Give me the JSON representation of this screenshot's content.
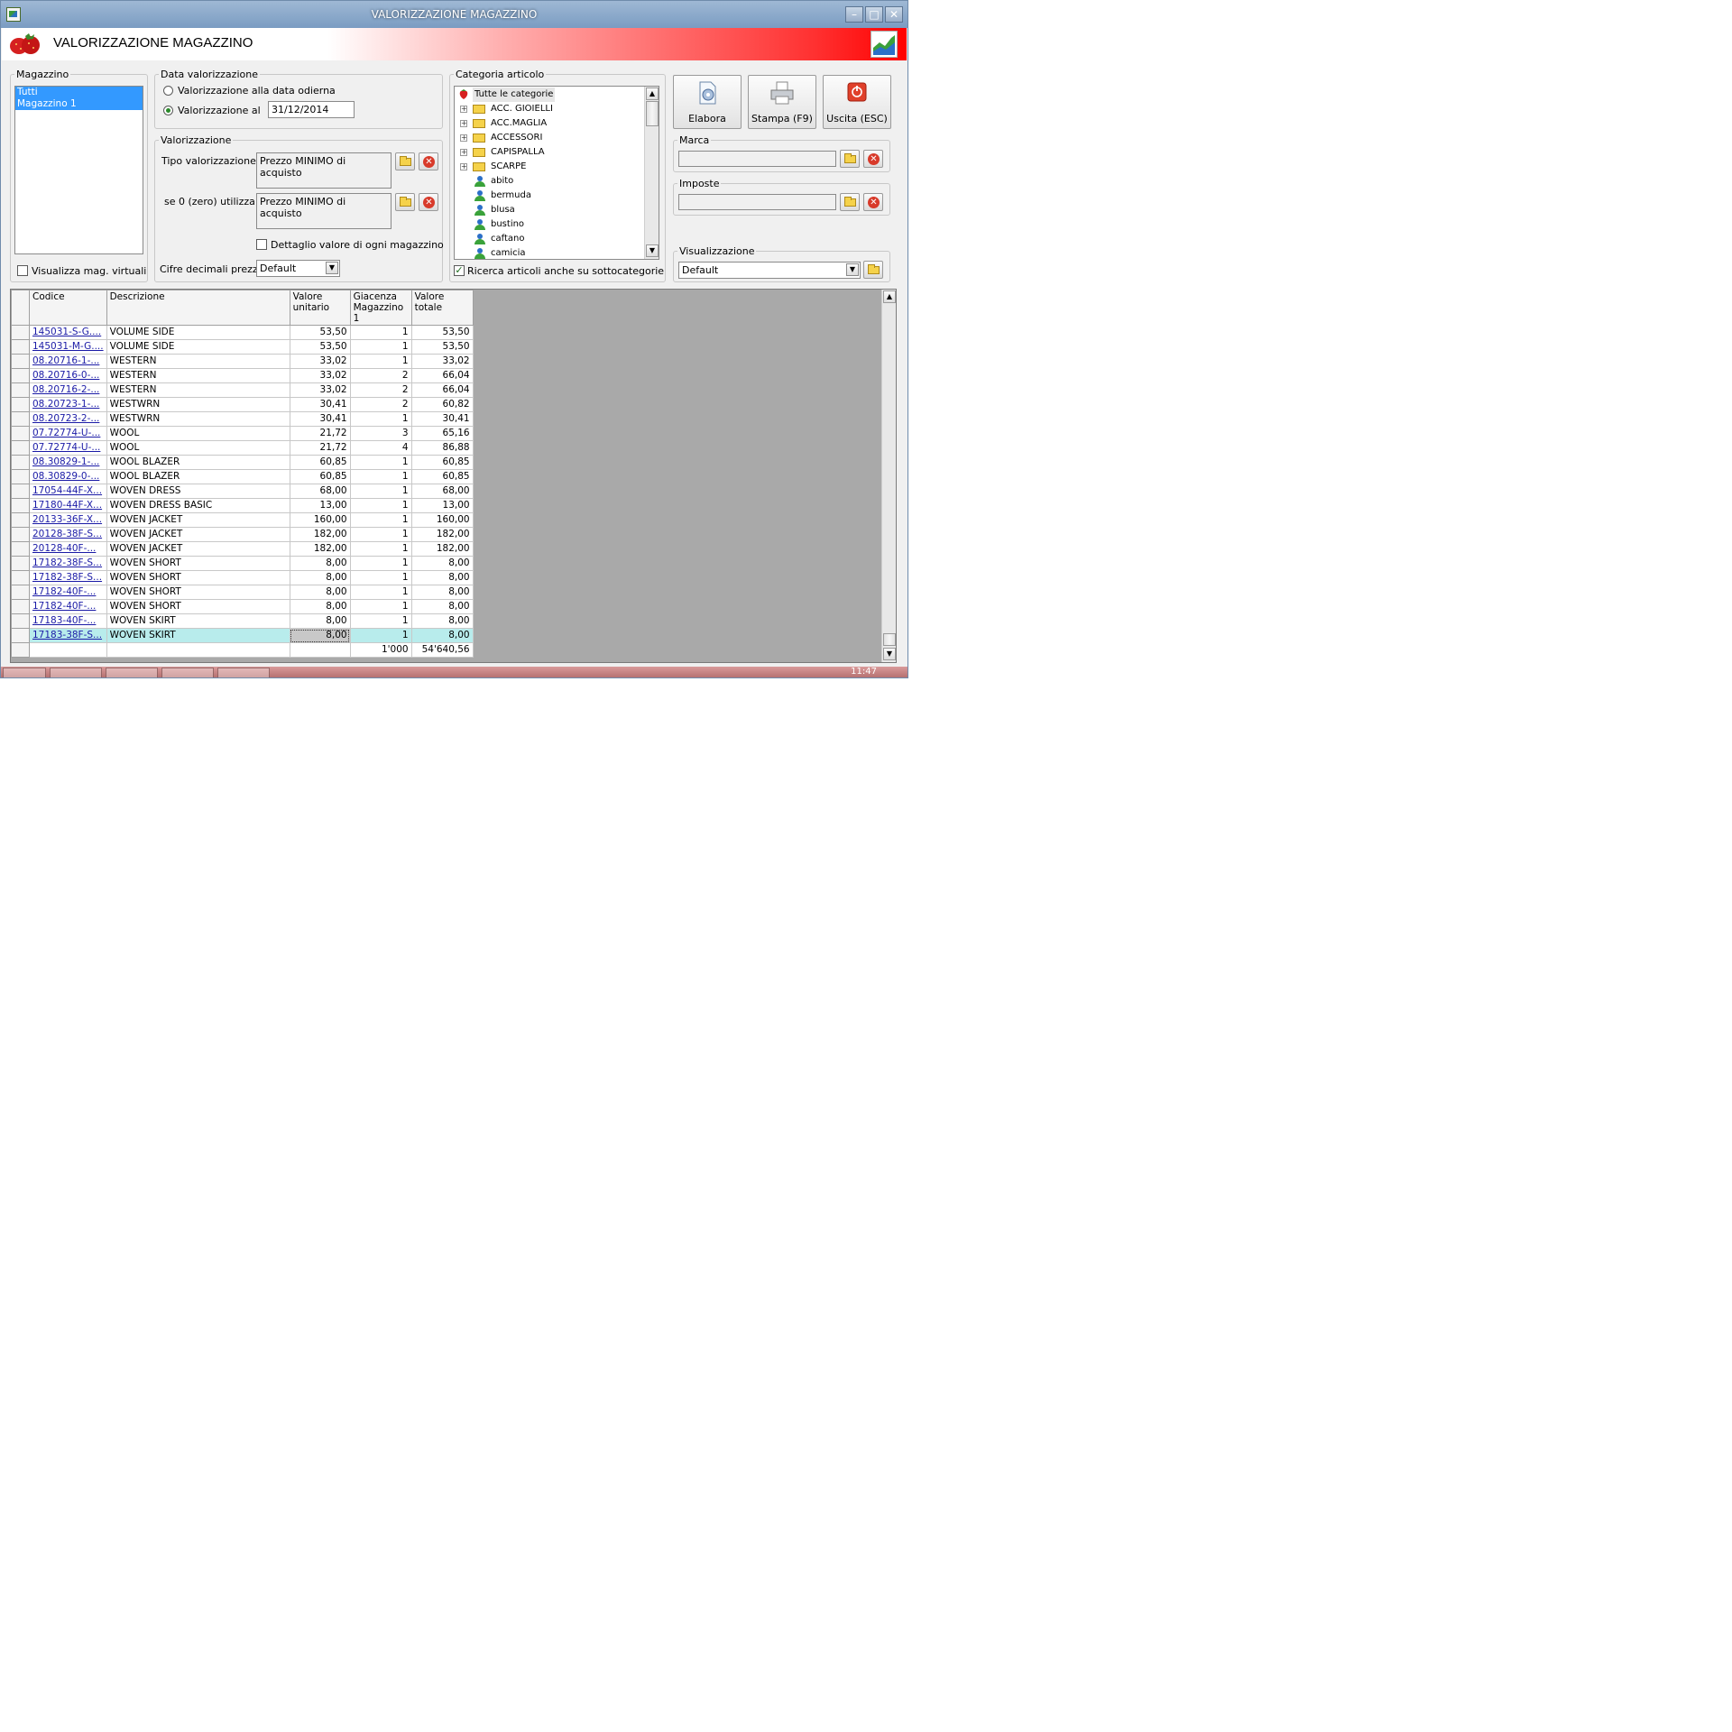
{
  "window": {
    "title": "VALORIZZAZIONE MAGAZZINO"
  },
  "header": {
    "title": "VALORIZZAZIONE MAGAZZINO"
  },
  "magazzino": {
    "legend": "Magazzino",
    "items": [
      "Tutti",
      "Magazzino 1"
    ],
    "virtual_label": "Visualizza mag. virtuali"
  },
  "data_valorizzazione": {
    "legend": "Data valorizzazione",
    "option_today": "Valorizzazione alla data odierna",
    "option_date": "Valorizzazione al",
    "date_value": "31/12/2014"
  },
  "valorizzazione": {
    "legend": "Valorizzazione",
    "tipo_label": "Tipo valorizzazione :",
    "tipo_value": "Prezzo MINIMO di acquisto",
    "zero_label": "se 0 (zero) utilizza :",
    "zero_value": "Prezzo MINIMO di acquisto",
    "dettaglio_label": "Dettaglio valore di ogni magazzino",
    "cifre_label": "Cifre decimali prezzi :",
    "cifre_value": "Default"
  },
  "categoria": {
    "legend": "Categoria articolo",
    "root": "Tutte le categorie",
    "folders": [
      "ACC. GIOIELLI",
      "ACC.MAGLIA",
      "ACCESSORI",
      "CAPISPALLA",
      "SCARPE"
    ],
    "leaves": [
      "abito",
      "bermuda",
      "blusa",
      "bustino",
      "caftano",
      "camicia"
    ],
    "subcat_label": "Ricerca articoli anche su sottocategorie"
  },
  "actions": {
    "elabora": "Elabora",
    "stampa": "Stampa (F9)",
    "uscita": "Uscita (ESC)"
  },
  "marca": {
    "legend": "Marca"
  },
  "imposte": {
    "legend": "Imposte"
  },
  "visualizzazione": {
    "legend": "Visualizzazione",
    "value": "Default"
  },
  "grid": {
    "headers": {
      "codice": "Codice",
      "descrizione": "Descrizione",
      "valore_unitario": "Valore unitario",
      "giacenza": "Giacenza Magazzino 1",
      "valore_totale": "Valore totale"
    },
    "rows": [
      {
        "codice": "145031-S-G....",
        "descrizione": "VOLUME SIDE",
        "unitario": "53,50",
        "giacenza": "1",
        "totale": "53,50"
      },
      {
        "codice": "145031-M-G....",
        "descrizione": "VOLUME SIDE",
        "unitario": "53,50",
        "giacenza": "1",
        "totale": "53,50"
      },
      {
        "codice": "08.20716-1-...",
        "descrizione": "WESTERN",
        "unitario": "33,02",
        "giacenza": "1",
        "totale": "33,02"
      },
      {
        "codice": "08.20716-0-...",
        "descrizione": "WESTERN",
        "unitario": "33,02",
        "giacenza": "2",
        "totale": "66,04"
      },
      {
        "codice": "08.20716-2-...",
        "descrizione": "WESTERN",
        "unitario": "33,02",
        "giacenza": "2",
        "totale": "66,04"
      },
      {
        "codice": "08.20723-1-...",
        "descrizione": "WESTWRN",
        "unitario": "30,41",
        "giacenza": "2",
        "totale": "60,82"
      },
      {
        "codice": "08.20723-2-...",
        "descrizione": "WESTWRN",
        "unitario": "30,41",
        "giacenza": "1",
        "totale": "30,41"
      },
      {
        "codice": "07.72774-U-...",
        "descrizione": "WOOL",
        "unitario": "21,72",
        "giacenza": "3",
        "totale": "65,16"
      },
      {
        "codice": "07.72774-U-...",
        "descrizione": "WOOL",
        "unitario": "21,72",
        "giacenza": "4",
        "totale": "86,88"
      },
      {
        "codice": "08.30829-1-...",
        "descrizione": "WOOL BLAZER",
        "unitario": "60,85",
        "giacenza": "1",
        "totale": "60,85"
      },
      {
        "codice": "08.30829-0-...",
        "descrizione": "WOOL BLAZER",
        "unitario": "60,85",
        "giacenza": "1",
        "totale": "60,85"
      },
      {
        "codice": "17054-44F-X...",
        "descrizione": "WOVEN DRESS",
        "unitario": "68,00",
        "giacenza": "1",
        "totale": "68,00"
      },
      {
        "codice": "17180-44F-X...",
        "descrizione": "WOVEN DRESS BASIC",
        "unitario": "13,00",
        "giacenza": "1",
        "totale": "13,00"
      },
      {
        "codice": "20133-36F-X...",
        "descrizione": "WOVEN JACKET",
        "unitario": "160,00",
        "giacenza": "1",
        "totale": "160,00"
      },
      {
        "codice": "20128-38F-S...",
        "descrizione": "WOVEN JACKET",
        "unitario": "182,00",
        "giacenza": "1",
        "totale": "182,00"
      },
      {
        "codice": "20128-40F-...",
        "descrizione": "WOVEN JACKET",
        "unitario": "182,00",
        "giacenza": "1",
        "totale": "182,00"
      },
      {
        "codice": "17182-38F-S...",
        "descrizione": "WOVEN SHORT",
        "unitario": "8,00",
        "giacenza": "1",
        "totale": "8,00"
      },
      {
        "codice": "17182-38F-S...",
        "descrizione": "WOVEN SHORT",
        "unitario": "8,00",
        "giacenza": "1",
        "totale": "8,00"
      },
      {
        "codice": "17182-40F-...",
        "descrizione": "WOVEN SHORT",
        "unitario": "8,00",
        "giacenza": "1",
        "totale": "8,00"
      },
      {
        "codice": "17182-40F-...",
        "descrizione": "WOVEN SHORT",
        "unitario": "8,00",
        "giacenza": "1",
        "totale": "8,00"
      },
      {
        "codice": "17183-40F-...",
        "descrizione": "WOVEN SKIRT",
        "unitario": "8,00",
        "giacenza": "1",
        "totale": "8,00"
      },
      {
        "codice": "17183-38F-S...",
        "descrizione": "WOVEN SKIRT",
        "unitario": "8,00",
        "giacenza": "1",
        "totale": "8,00"
      }
    ],
    "totals": {
      "giacenza": "1'000",
      "totale": "54'640,56"
    }
  },
  "taskbar": {
    "clock": "11:47"
  },
  "colors": {
    "header_accent": "#ff0000",
    "selection": "#3399ff",
    "row_selected": "#b8ecec",
    "link": "#1a1aa6"
  }
}
